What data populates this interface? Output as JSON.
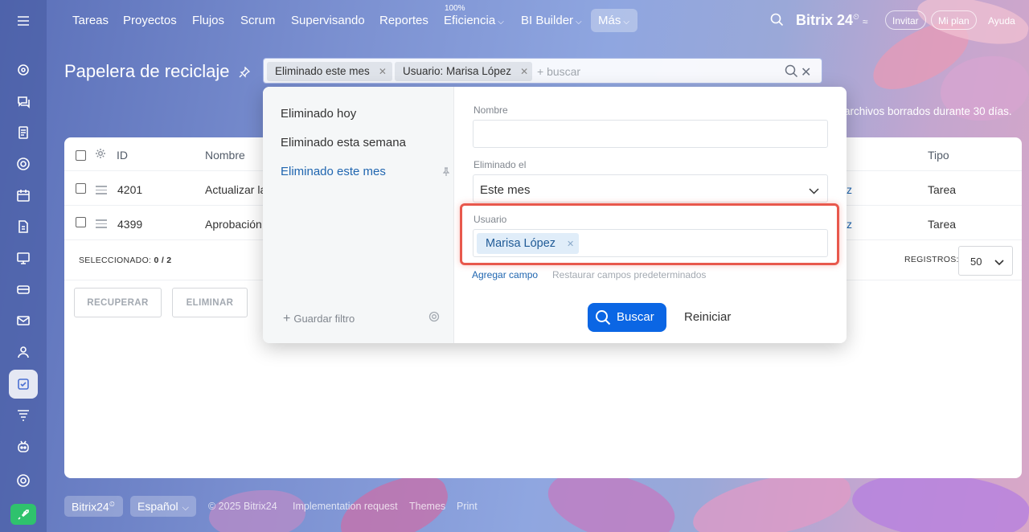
{
  "nav": {
    "items": [
      "Tareas",
      "Proyectos",
      "Flujos",
      "Scrum",
      "Supervisando",
      "Reportes",
      "Eficiencia",
      "BI Builder",
      "Más"
    ],
    "efficiency_badge": "100%",
    "brand": "Bitrix 24",
    "invite": "Invitar",
    "my_plan": "Mi plan",
    "help": "Ayuda"
  },
  "page": {
    "title": "Papelera de reciclaje",
    "info": "archivos borrados durante 30 días."
  },
  "filter": {
    "chips": [
      "Eliminado este mes",
      "Usuario: Marisa López"
    ],
    "placeholder": "+ buscar"
  },
  "popup": {
    "presets": [
      "Eliminado hoy",
      "Eliminado esta semana",
      "Eliminado este mes"
    ],
    "active_preset": "Eliminado este mes",
    "save_filter": "Guardar filtro",
    "fields": {
      "name_label": "Nombre",
      "name_value": "",
      "deleted_label": "Eliminado el",
      "deleted_value": "Este mes",
      "user_label": "Usuario",
      "user_value": "Marisa López"
    },
    "add_field": "Agregar campo",
    "restore_fields": "Restaurar campos predeterminados",
    "search_button": "Buscar",
    "reset_button": "Reiniciar"
  },
  "table": {
    "headers": {
      "id": "ID",
      "name": "Nombre",
      "type": "Tipo"
    },
    "rows": [
      {
        "id": "4201",
        "name": "Actualizar la",
        "user_tail": "z",
        "type": "Tarea"
      },
      {
        "id": "4399",
        "name": "Aprobación",
        "user_tail": "z",
        "type": "Tarea"
      }
    ],
    "selected_label": "SELECCIONADO:",
    "selected_value": "0 / 2",
    "records_label": "REGISTROS:",
    "records_value": "50",
    "recover_button": "RECUPERAR",
    "delete_button": "ELIMINAR"
  },
  "footer": {
    "brand": "Bitrix24",
    "language": "Español",
    "copyright": "© 2025 Bitrix24",
    "implementation": "Implementation request",
    "themes": "Themes",
    "print": "Print"
  },
  "colors": {
    "accent": "#0b66e4",
    "highlight": "#e8584c",
    "link": "#2066b0"
  }
}
